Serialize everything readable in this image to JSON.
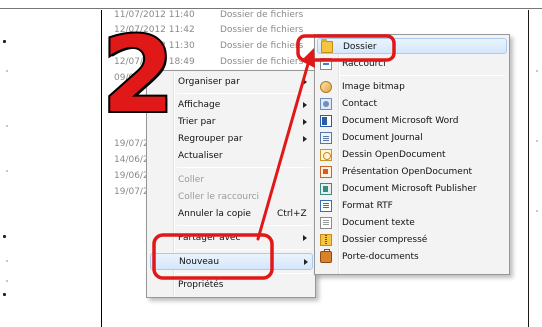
{
  "explorer_rows": [
    {
      "date": "12/07/2012 11:42",
      "type": "Dossier de fichiers"
    },
    {
      "date": "12/07/2012 11:30",
      "type": "Dossier de fichiers"
    },
    {
      "date": "12/07/2012 18:49",
      "type": "Dossier de fichiers"
    },
    {
      "date": "09/07/2012",
      "type": ""
    },
    {
      "date": "19/07/20",
      "type": ""
    },
    {
      "date": "14/06/20",
      "type": ""
    },
    {
      "date": "19/06/20",
      "type": ""
    },
    {
      "date": "19/07/20",
      "type": ""
    }
  ],
  "context_menu": {
    "organize": "Organiser par",
    "view": "Affichage",
    "sort": "Trier par",
    "group": "Regrouper par",
    "refresh": "Actualiser",
    "paste": "Coller",
    "paste_shortcut": "Coller le raccourci",
    "undo_copy": "Annuler la copie",
    "undo_shortcut": "Ctrl+Z",
    "share": "Partager avec",
    "new": "Nouveau",
    "properties": "Propriétés"
  },
  "submenu": {
    "folder": "Dossier",
    "shortcut": "Raccourci",
    "bitmap": "Image bitmap",
    "contact": "Contact",
    "word": "Document Microsoft Word",
    "journal": "Document Journal",
    "drawing": "Dessin OpenDocument",
    "presentation": "Présentation OpenDocument",
    "publisher": "Document Microsoft Publisher",
    "rtf": "Format RTF",
    "text": "Document texte",
    "zip": "Dossier compressé",
    "briefcase": "Porte-documents"
  },
  "annotation": {
    "step_number": "2",
    "highlight_color": "#e01818"
  }
}
